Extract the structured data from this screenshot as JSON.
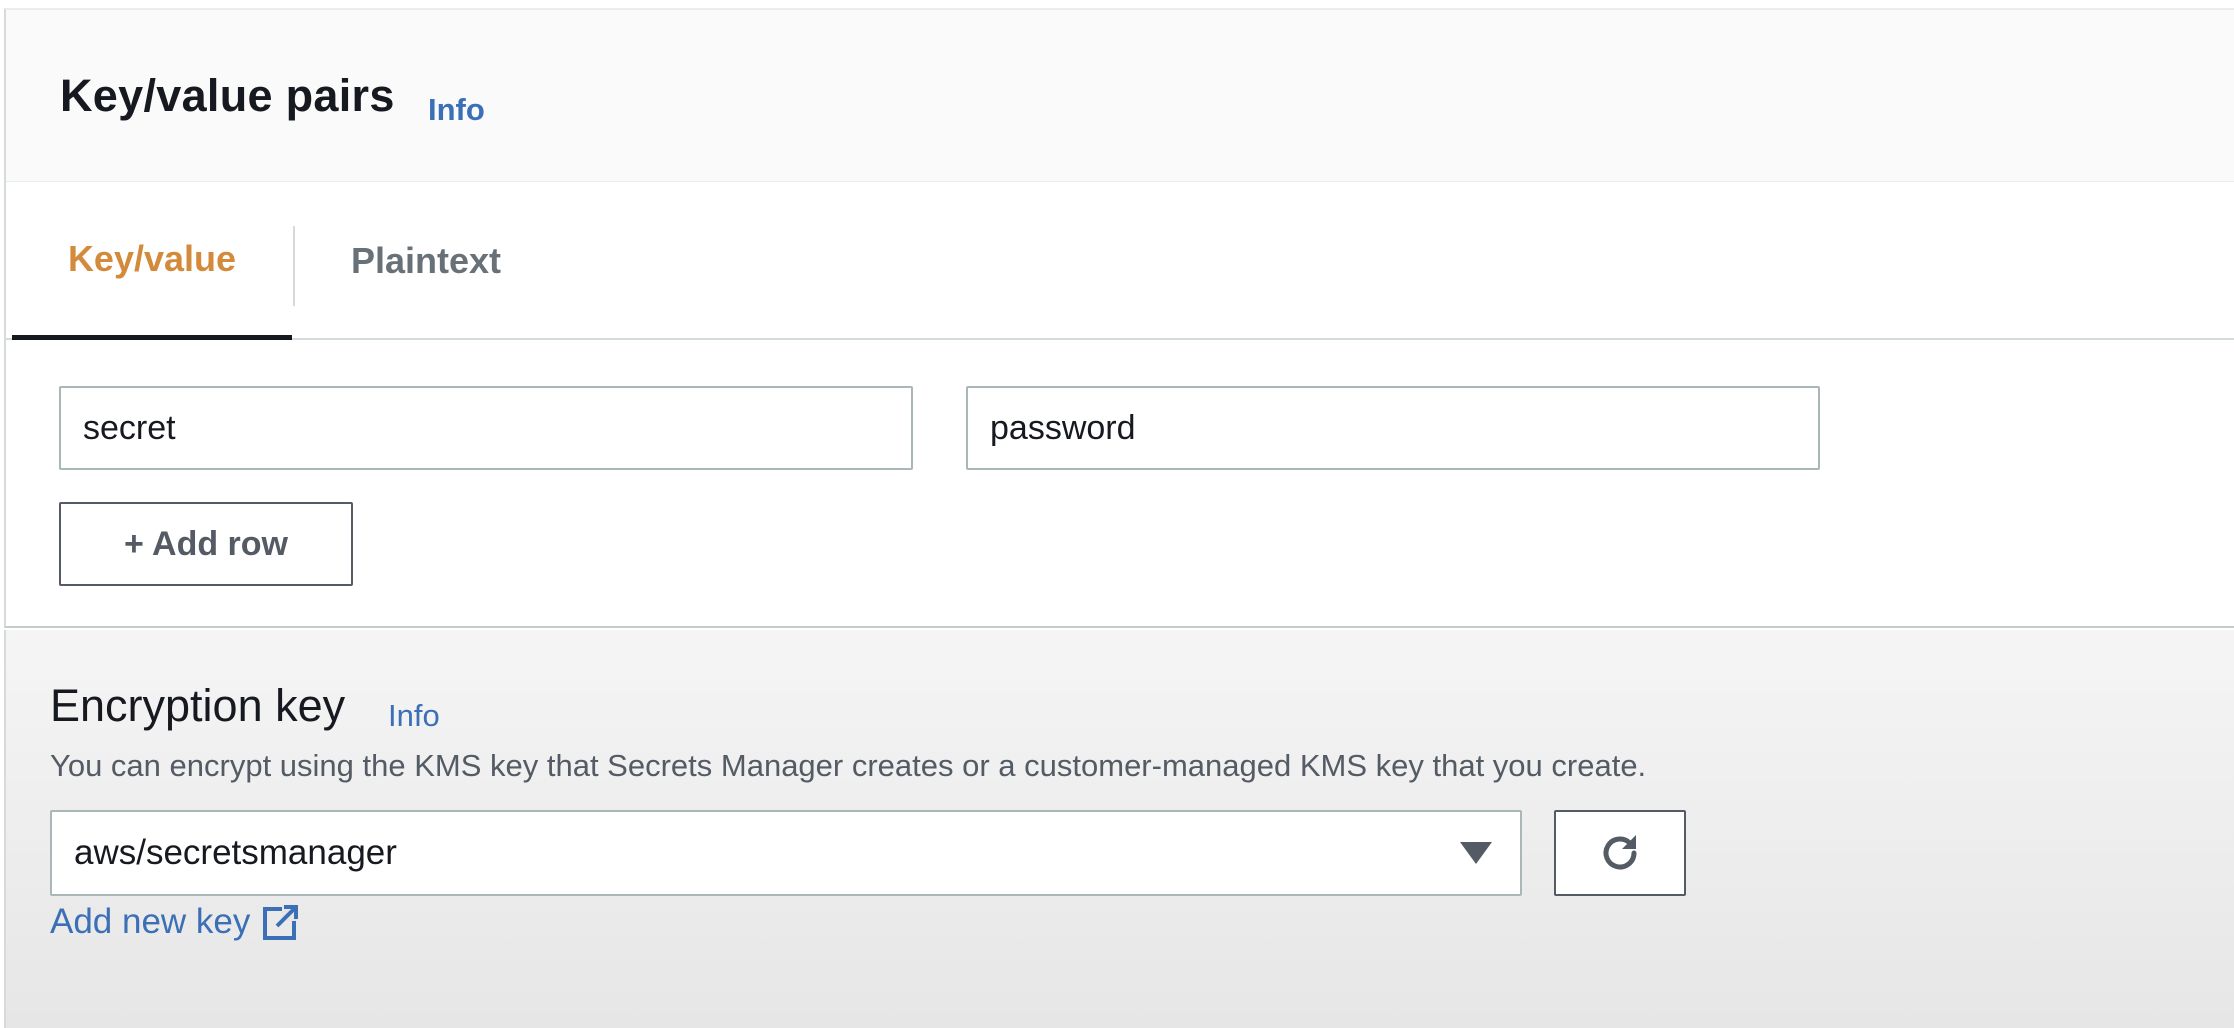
{
  "kv_section": {
    "title": "Key/value pairs",
    "info_label": "Info",
    "tabs": [
      {
        "label": "Key/value",
        "active": true
      },
      {
        "label": "Plaintext",
        "active": false
      }
    ],
    "rows": [
      {
        "key": "secret",
        "value": "password"
      }
    ],
    "add_row_label": "+ Add row"
  },
  "encryption_section": {
    "title": "Encryption key",
    "info_label": "Info",
    "description": "You can encrypt using the KMS key that Secrets Manager creates or a customer-managed KMS key that you create.",
    "selected_key": "aws/secretsmanager",
    "refresh_icon": "refresh-icon",
    "add_key_label": "Add new key",
    "external_icon": "external-link-icon"
  },
  "colors": {
    "accent_tab": "#d38a3b",
    "link": "#3b6fb6",
    "border": "#aab7b8"
  }
}
